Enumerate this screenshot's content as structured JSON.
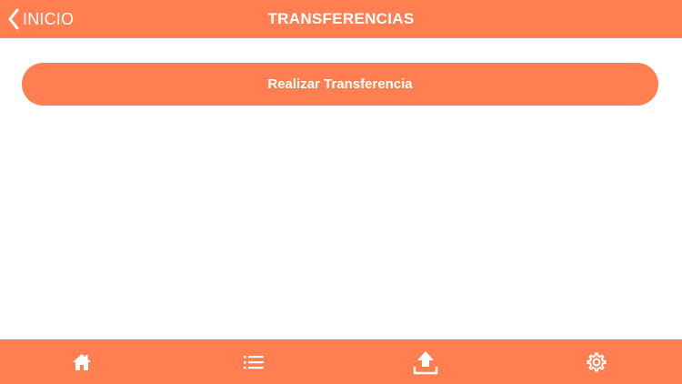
{
  "theme": {
    "accent": "#FF7F50",
    "background": "#FFFFFF",
    "text_on_accent": "#FFFFFF"
  },
  "navbar": {
    "back_icon": "chevron-left-icon",
    "back_label": "INICIO",
    "title": "TRANSFERENCIAS"
  },
  "main": {
    "action_button_label": "Realizar Transferencia"
  },
  "tabbar": {
    "tabs": [
      {
        "icon": "home-icon"
      },
      {
        "icon": "list-icon"
      },
      {
        "icon": "upload-icon"
      },
      {
        "icon": "gear-icon"
      }
    ]
  }
}
